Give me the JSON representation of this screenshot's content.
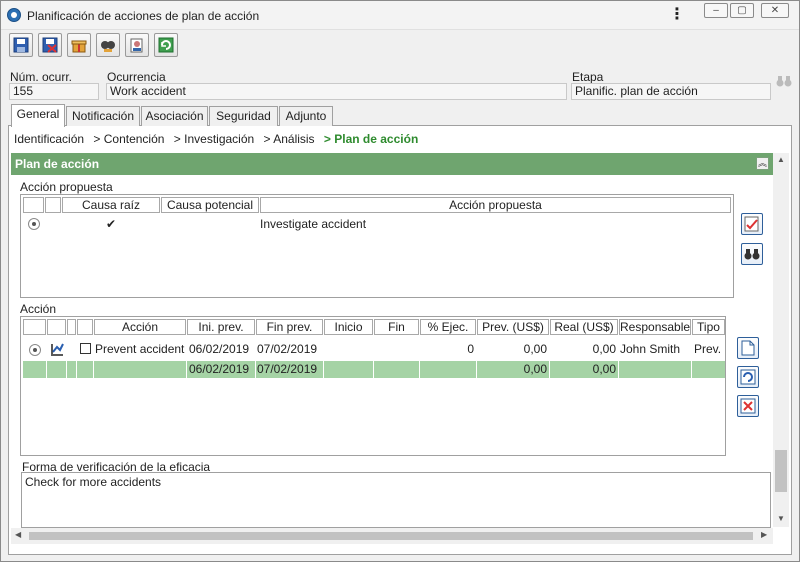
{
  "window": {
    "title": "Planificación de acciones de plan de acción"
  },
  "toolbar": {
    "buttons": [
      {
        "icon": "save-icon"
      },
      {
        "icon": "save-close-icon"
      },
      {
        "icon": "gift-icon"
      },
      {
        "icon": "search-user-icon"
      },
      {
        "icon": "user-doc-icon"
      },
      {
        "icon": "refresh-icon"
      }
    ]
  },
  "header": {
    "occ_num_label": "Núm. ocurr.",
    "occ_num_value": "155",
    "occurrence_label": "Ocurrencia",
    "occurrence_value": "Work accident",
    "stage_label": "Etapa",
    "stage_value": "Planific. plan de acción"
  },
  "tabs": [
    {
      "label": "General",
      "active": true
    },
    {
      "label": "Notificación"
    },
    {
      "label": "Asociación"
    },
    {
      "label": "Seguridad"
    },
    {
      "label": "Adjunto"
    }
  ],
  "breadcrumb": [
    {
      "label": "Identificación"
    },
    {
      "label": "> Contención"
    },
    {
      "label": "> Investigación"
    },
    {
      "label": "> Análisis"
    },
    {
      "label": "> Plan de acción",
      "current": true
    }
  ],
  "section": {
    "title": "Plan de acción"
  },
  "proposed": {
    "label": "Acción propuesta",
    "columns": [
      "Causa raíz",
      "Causa potencial",
      "Acción propuesta"
    ],
    "rows": [
      {
        "root_cause": "✔",
        "potential_cause": "",
        "action": "Investigate accident"
      }
    ]
  },
  "actions": {
    "label": "Acción",
    "columns": [
      "Acción",
      "Ini. prev.",
      "Fin prev.",
      "Inicio",
      "Fin",
      "% Ejec.",
      "Prev. (US$)",
      "Real (US$)",
      "Responsable",
      "Tipo"
    ],
    "rows": [
      {
        "name": "Prevent accident",
        "ini_prev": "06/02/2019",
        "fin_prev": "07/02/2019",
        "inicio": "",
        "fin": "",
        "pct": "0",
        "prev_cost": "0,00",
        "real_cost": "0,00",
        "responsible": "John Smith",
        "type": "Prev."
      }
    ],
    "totals": {
      "ini_prev": "06/02/2019",
      "fin_prev": "07/02/2019",
      "prev_cost": "0,00",
      "real_cost": "0,00"
    }
  },
  "verification": {
    "label": "Forma de verificación de la eficacia",
    "value": "Check for more accidents"
  },
  "colors": {
    "section_header": "#6fa56f",
    "selected_row": "#a5d3a5",
    "breadcrumb_current": "#2e8b2e"
  }
}
